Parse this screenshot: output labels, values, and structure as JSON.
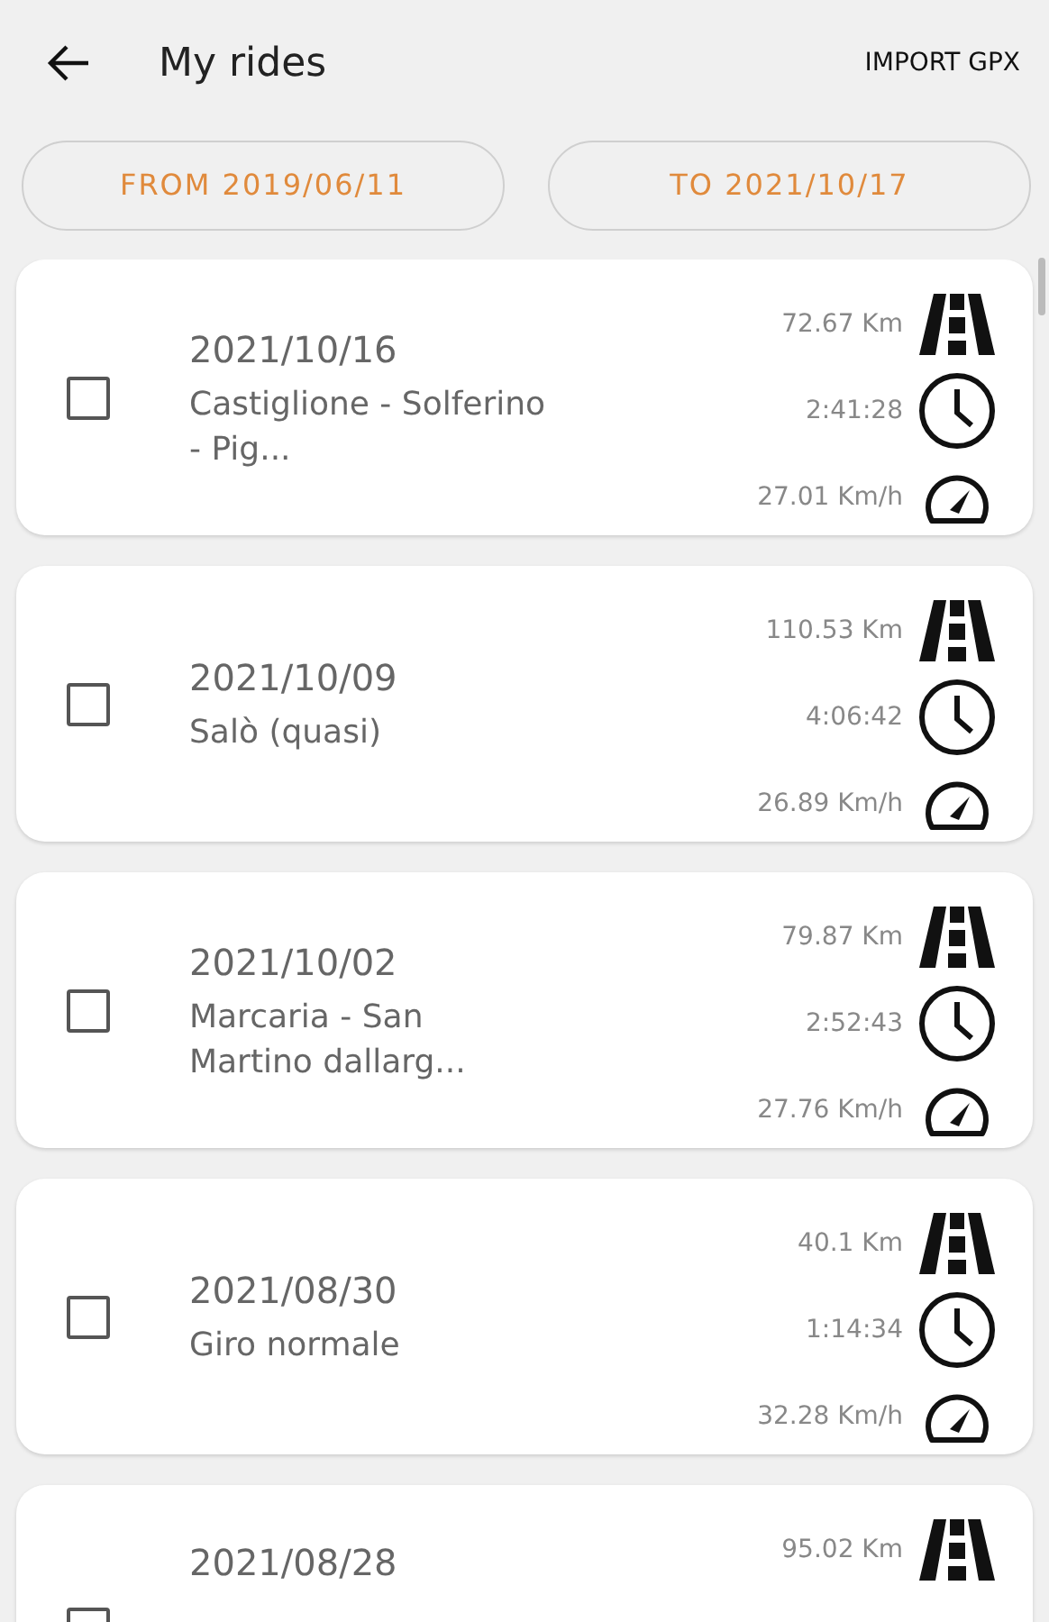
{
  "header": {
    "title": "My rides",
    "action": "IMPORT GPX"
  },
  "filters": [
    {
      "label": "FROM 2019/06/11"
    },
    {
      "label": "TO 2021/10/17"
    }
  ],
  "rides": [
    {
      "checked": false,
      "date": "2021/10/16",
      "title": "Castiglione - Solferino - Pig...",
      "distance": "72.67 Km",
      "time": "2:41:28",
      "speed": "27.01 Km/h"
    },
    {
      "checked": false,
      "date": "2021/10/09",
      "title": "Salò (quasi)",
      "distance": "110.53 Km",
      "time": "4:06:42",
      "speed": "26.89 Km/h"
    },
    {
      "checked": false,
      "date": "2021/10/02",
      "title": "Marcaria - San Martino dallarg...",
      "distance": "79.87 Km",
      "time": "2:52:43",
      "speed": "27.76 Km/h"
    },
    {
      "checked": false,
      "date": "2021/08/30",
      "title": "Giro normale",
      "distance": "40.1 Km",
      "time": "1:14:34",
      "speed": "32.28 Km/h"
    },
    {
      "checked": false,
      "date": "2021/08/28",
      "distance": "95.02 Km"
    }
  ]
}
